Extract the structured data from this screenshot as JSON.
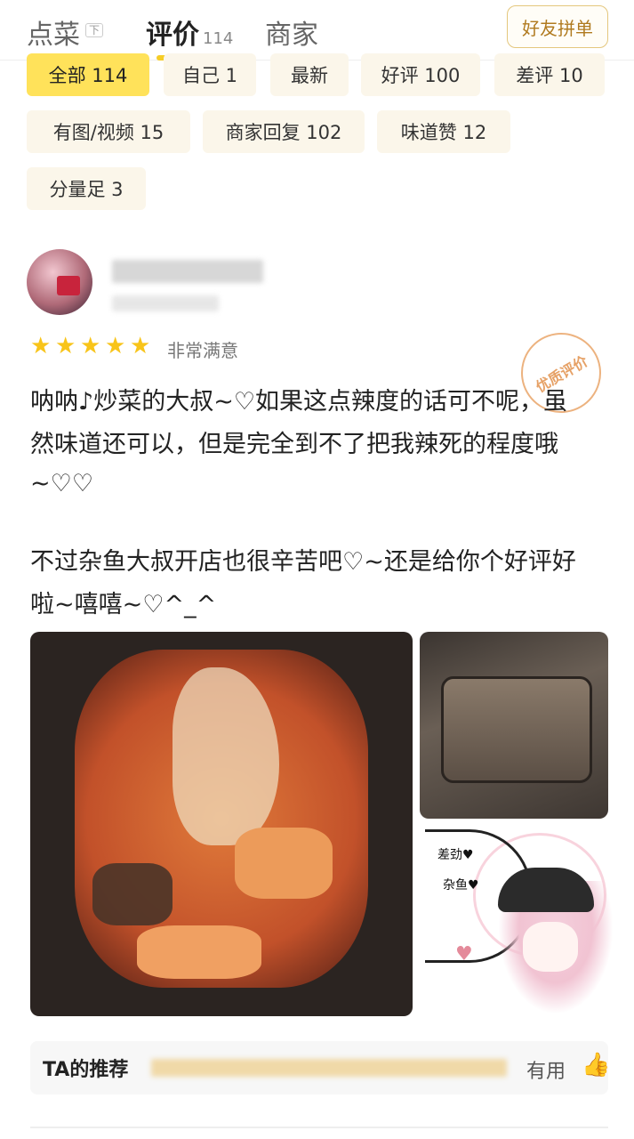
{
  "tabs": [
    {
      "label": "点菜",
      "tag": "下"
    },
    {
      "label": "评价",
      "count": "114"
    },
    {
      "label": "商家"
    }
  ],
  "pin_button": "好友拼单",
  "filters": [
    {
      "label": "全部 114"
    },
    {
      "label": "自己 1"
    },
    {
      "label": "最新"
    },
    {
      "label": "好评 100"
    },
    {
      "label": "差评 10"
    },
    {
      "label": "有图/视频 15"
    },
    {
      "label": "商家回复 102"
    },
    {
      "label": "味道赞 12"
    },
    {
      "label": "分量足 3"
    }
  ],
  "review": {
    "rating": 5,
    "rating_text": "非常满意",
    "quality_badge": "优质评价",
    "lines": [
      "呐呐♪炒菜的大叔~♡如果这点辣度的话可不呢，虽",
      "然味道还可以，但是完全到不了把我辣死的程度哦",
      "~♡♡",
      "",
      "不过杂鱼大叔开店也很辛苦吧♡~还是给你个好评好",
      "啦~嘻嘻~♡^_^"
    ],
    "sticker_texts": [
      "差劲♥",
      "杂鱼♥"
    ]
  },
  "recommend_label": "TA的推荐",
  "useful_label": "有用",
  "colors": {
    "accent": "#ffe25a",
    "star": "#f8c41a",
    "pin": "#b07a1f"
  }
}
